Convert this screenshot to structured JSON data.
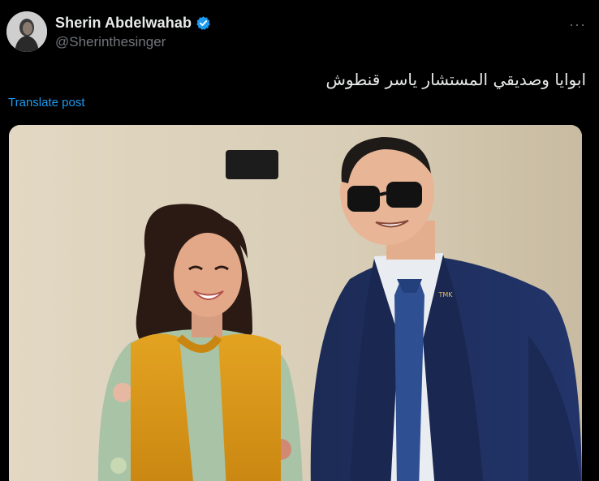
{
  "post": {
    "author": {
      "display_name": "Sherin Abdelwahab",
      "handle": "@Sherinthesinger",
      "verified": true,
      "verified_icon": "verified-badge-icon"
    },
    "more_label": "···",
    "text": "ابوايا وصديقي المستشار ياسر قنطوش",
    "translate_label": "Translate post",
    "media": {
      "type": "photo",
      "badge_text": "TMK"
    }
  },
  "colors": {
    "background": "#000000",
    "text_primary": "#e7e9ea",
    "text_secondary": "#71767b",
    "link": "#1d9bf0",
    "verified": "#1d9bf0"
  }
}
